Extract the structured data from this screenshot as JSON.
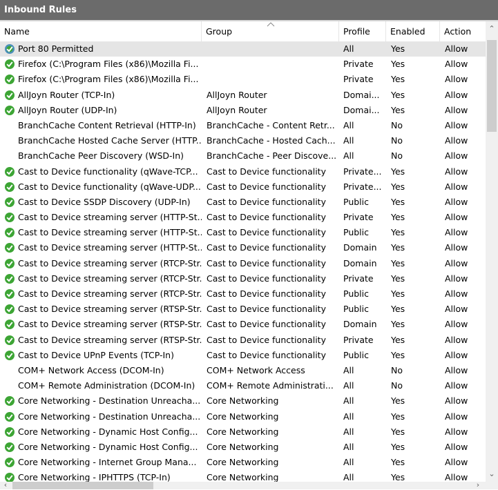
{
  "window": {
    "title": "Inbound Rules"
  },
  "columns": {
    "name": "Name",
    "group": "Group",
    "profile": "Profile",
    "enabled": "Enabled",
    "action": "Action"
  },
  "rows": [
    {
      "icon": "globe-check",
      "name": "Port 80 Permitted",
      "group": "",
      "profile": "All",
      "enabled": "Yes",
      "action": "Allow"
    },
    {
      "icon": "check",
      "name": "Firefox (C:\\Program Files (x86)\\Mozilla Fi...",
      "group": "",
      "profile": "Private",
      "enabled": "Yes",
      "action": "Allow"
    },
    {
      "icon": "check",
      "name": "Firefox (C:\\Program Files (x86)\\Mozilla Fi...",
      "group": "",
      "profile": "Private",
      "enabled": "Yes",
      "action": "Allow"
    },
    {
      "icon": "check",
      "name": "AllJoyn Router (TCP-In)",
      "group": "AllJoyn Router",
      "profile": "Domai...",
      "enabled": "Yes",
      "action": "Allow"
    },
    {
      "icon": "check",
      "name": "AllJoyn Router (UDP-In)",
      "group": "AllJoyn Router",
      "profile": "Domai...",
      "enabled": "Yes",
      "action": "Allow"
    },
    {
      "icon": "none",
      "name": "BranchCache Content Retrieval (HTTP-In)",
      "group": "BranchCache - Content Retr...",
      "profile": "All",
      "enabled": "No",
      "action": "Allow"
    },
    {
      "icon": "none",
      "name": "BranchCache Hosted Cache Server (HTTP...",
      "group": "BranchCache - Hosted Cach...",
      "profile": "All",
      "enabled": "No",
      "action": "Allow"
    },
    {
      "icon": "none",
      "name": "BranchCache Peer Discovery (WSD-In)",
      "group": "BranchCache - Peer Discove...",
      "profile": "All",
      "enabled": "No",
      "action": "Allow"
    },
    {
      "icon": "check",
      "name": "Cast to Device functionality (qWave-TCP...",
      "group": "Cast to Device functionality",
      "profile": "Private...",
      "enabled": "Yes",
      "action": "Allow"
    },
    {
      "icon": "check",
      "name": "Cast to Device functionality (qWave-UDP...",
      "group": "Cast to Device functionality",
      "profile": "Private...",
      "enabled": "Yes",
      "action": "Allow"
    },
    {
      "icon": "check",
      "name": "Cast to Device SSDP Discovery (UDP-In)",
      "group": "Cast to Device functionality",
      "profile": "Public",
      "enabled": "Yes",
      "action": "Allow"
    },
    {
      "icon": "check",
      "name": "Cast to Device streaming server (HTTP-St...",
      "group": "Cast to Device functionality",
      "profile": "Private",
      "enabled": "Yes",
      "action": "Allow"
    },
    {
      "icon": "check",
      "name": "Cast to Device streaming server (HTTP-St...",
      "group": "Cast to Device functionality",
      "profile": "Public",
      "enabled": "Yes",
      "action": "Allow"
    },
    {
      "icon": "check",
      "name": "Cast to Device streaming server (HTTP-St...",
      "group": "Cast to Device functionality",
      "profile": "Domain",
      "enabled": "Yes",
      "action": "Allow"
    },
    {
      "icon": "check",
      "name": "Cast to Device streaming server (RTCP-Str...",
      "group": "Cast to Device functionality",
      "profile": "Domain",
      "enabled": "Yes",
      "action": "Allow"
    },
    {
      "icon": "check",
      "name": "Cast to Device streaming server (RTCP-Str...",
      "group": "Cast to Device functionality",
      "profile": "Private",
      "enabled": "Yes",
      "action": "Allow"
    },
    {
      "icon": "check",
      "name": "Cast to Device streaming server (RTCP-Str...",
      "group": "Cast to Device functionality",
      "profile": "Public",
      "enabled": "Yes",
      "action": "Allow"
    },
    {
      "icon": "check",
      "name": "Cast to Device streaming server (RTSP-Str...",
      "group": "Cast to Device functionality",
      "profile": "Public",
      "enabled": "Yes",
      "action": "Allow"
    },
    {
      "icon": "check",
      "name": "Cast to Device streaming server (RTSP-Str...",
      "group": "Cast to Device functionality",
      "profile": "Domain",
      "enabled": "Yes",
      "action": "Allow"
    },
    {
      "icon": "check",
      "name": "Cast to Device streaming server (RTSP-Str...",
      "group": "Cast to Device functionality",
      "profile": "Private",
      "enabled": "Yes",
      "action": "Allow"
    },
    {
      "icon": "check",
      "name": "Cast to Device UPnP Events (TCP-In)",
      "group": "Cast to Device functionality",
      "profile": "Public",
      "enabled": "Yes",
      "action": "Allow"
    },
    {
      "icon": "none",
      "name": "COM+ Network Access (DCOM-In)",
      "group": "COM+ Network Access",
      "profile": "All",
      "enabled": "No",
      "action": "Allow"
    },
    {
      "icon": "none",
      "name": "COM+ Remote Administration (DCOM-In)",
      "group": "COM+ Remote Administrati...",
      "profile": "All",
      "enabled": "No",
      "action": "Allow"
    },
    {
      "icon": "check",
      "name": "Core Networking - Destination Unreacha...",
      "group": "Core Networking",
      "profile": "All",
      "enabled": "Yes",
      "action": "Allow"
    },
    {
      "icon": "check",
      "name": "Core Networking - Destination Unreacha...",
      "group": "Core Networking",
      "profile": "All",
      "enabled": "Yes",
      "action": "Allow"
    },
    {
      "icon": "check",
      "name": "Core Networking - Dynamic Host Config...",
      "group": "Core Networking",
      "profile": "All",
      "enabled": "Yes",
      "action": "Allow"
    },
    {
      "icon": "check",
      "name": "Core Networking - Dynamic Host Config...",
      "group": "Core Networking",
      "profile": "All",
      "enabled": "Yes",
      "action": "Allow"
    },
    {
      "icon": "check",
      "name": "Core Networking - Internet Group Mana...",
      "group": "Core Networking",
      "profile": "All",
      "enabled": "Yes",
      "action": "Allow"
    },
    {
      "icon": "check",
      "name": "Core Networking - IPHTTPS (TCP-In)",
      "group": "Core Networking",
      "profile": "All",
      "enabled": "Yes",
      "action": "Allow"
    }
  ],
  "colors": {
    "titlebar": "#6b6b6b",
    "check_green": "#3da535",
    "selected_row": "#e5e5e5"
  }
}
